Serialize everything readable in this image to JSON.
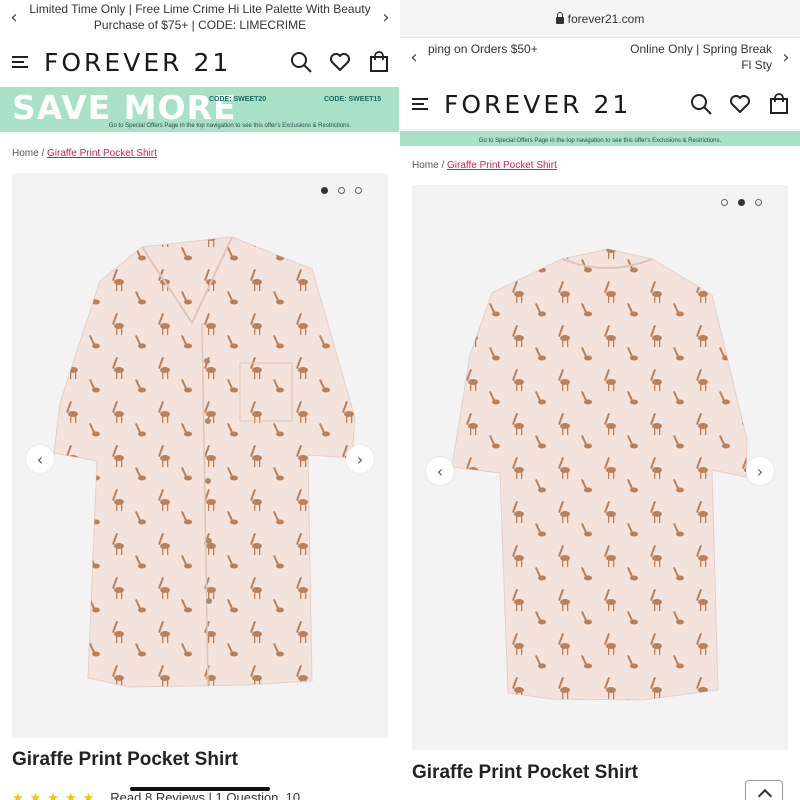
{
  "left": {
    "promo_text": "Limited Time Only | Free Lime Crime Hi Lite Palette With Beauty Purchase of $75+ | CODE: LIMECRIME",
    "logo": "FOREVER 21",
    "banner": {
      "headline": "SAVE MORE",
      "code1": "CODE: SWEET20",
      "code2": "CODE: SWEET15",
      "note": "Go to Special Offers Page in the top navigation to see this offer's Exclusions & Restrictions."
    },
    "breadcrumb": {
      "home": "Home",
      "sep": "/",
      "current": "Giraffe Print Pocket Shirt"
    },
    "carousel": {
      "active_index": 0,
      "count": 3
    },
    "product_title": "Giraffe Print Pocket Shirt",
    "reviews_text": "Read 8 Reviews | 1 Question, 10"
  },
  "right": {
    "url": "forever21.com",
    "promo_left": "ping on Orders $50+",
    "promo_right": "Online Only | Spring Break Fl Sty",
    "logo": "FOREVER 21",
    "banner_note": "Go to Special Offers Page in the top navigation to see this offer's Exclusions & Restrictions.",
    "breadcrumb": {
      "home": "Home",
      "sep": "/",
      "current": "Giraffe Print Pocket Shirt"
    },
    "carousel": {
      "active_index": 1,
      "count": 3
    },
    "product_title": "Giraffe Print Pocket Shirt"
  },
  "icons": [
    "chevron-left-icon",
    "chevron-right-icon",
    "menu-icon",
    "search-icon",
    "heart-icon",
    "bag-icon",
    "lock-icon",
    "star-icon"
  ],
  "colors": {
    "banner": "#a8e0c8",
    "link": "#c8215a",
    "shirt": "#f4e3dc",
    "stars": "#f4c40f"
  }
}
